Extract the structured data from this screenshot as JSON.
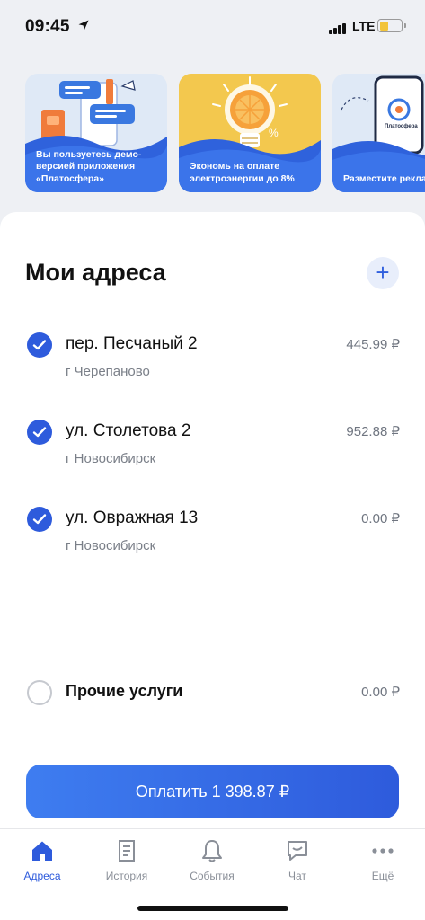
{
  "status_bar": {
    "time": "09:45",
    "network": "LTE"
  },
  "banners": [
    {
      "caption": "Вы пользуетесь демо-версией приложения «Платосфера»"
    },
    {
      "caption": "Экономь на оплате электроэнергии до 8%"
    },
    {
      "caption": "Разместите рекламу в Платосфере",
      "art_label": "Платосфера"
    }
  ],
  "main": {
    "title": "Мои адреса",
    "add_symbol": "+",
    "addresses": [
      {
        "street": "пер. Песчаный 2",
        "city": "г Черепаново",
        "amount": "445.99 ₽",
        "checked": true
      },
      {
        "street": "ул. Столетова 2",
        "city": "г Новосибирск",
        "amount": "952.88 ₽",
        "checked": true
      },
      {
        "street": "ул. Овражная 13",
        "city": "г Новосибирск",
        "amount": "0.00 ₽",
        "checked": true
      }
    ],
    "other_services": {
      "label": "Прочие услуги",
      "amount": "0.00 ₽",
      "checked": false
    },
    "pay_button": "Оплатить 1 398.87 ₽"
  },
  "tabbar": {
    "tabs": [
      {
        "label": "Адреса",
        "icon": "home-icon",
        "active": true
      },
      {
        "label": "История",
        "icon": "document-icon",
        "active": false
      },
      {
        "label": "События",
        "icon": "bell-icon",
        "active": false
      },
      {
        "label": "Чат",
        "icon": "chat-icon",
        "active": false
      },
      {
        "label": "Ещё",
        "icon": "more-icon",
        "active": false
      }
    ]
  },
  "colors": {
    "accent": "#2e5bdc",
    "accent_light": "#3e7df0",
    "muted": "#7a7f88",
    "background": "#eef0f4"
  }
}
